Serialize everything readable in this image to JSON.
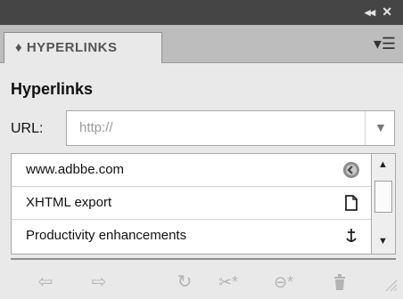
{
  "panel": {
    "tab_label": "♦ HYPERLINKS",
    "heading": "Hyperlinks",
    "url_label": "URL:",
    "url_value": "http://"
  },
  "hyperlinks": [
    {
      "label": "www.adbbe.com",
      "icon": "globe-link-icon"
    },
    {
      "label": "XHTML export",
      "icon": "page-icon"
    },
    {
      "label": "Productivity enhancements",
      "icon": "anchor-icon"
    }
  ],
  "toolbar_icons": [
    "go-to-source-icon",
    "go-to-destination-icon",
    "update-icon",
    "new-cross-reference-icon",
    "new-hyperlink-icon",
    "delete-icon"
  ],
  "colors": {
    "titlebar": "#454545",
    "tab_strip": "#bdbdbd",
    "panel_bg": "#e9e9e9",
    "disabled_icon": "#b4b4b4"
  }
}
